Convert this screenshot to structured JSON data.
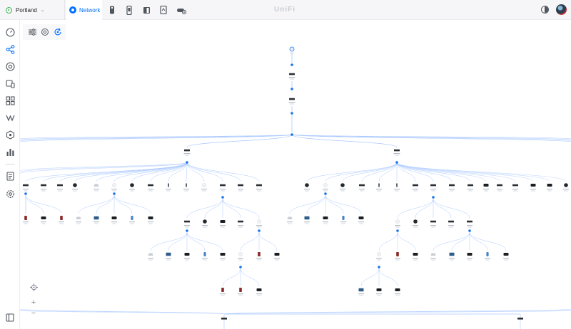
{
  "header": {
    "site_name": "Portland",
    "tabs": [
      {
        "label": "Network",
        "icon": "network-icon",
        "active": true
      },
      {
        "label": "",
        "icon": "protect-camera-icon"
      },
      {
        "label": "",
        "icon": "access-reader-icon"
      },
      {
        "label": "",
        "icon": "talk-phone-icon"
      },
      {
        "label": "",
        "icon": "connect-device-icon"
      },
      {
        "label": "",
        "icon": "cloud-gateway-icon"
      }
    ],
    "brand": "UniFi",
    "theme_icon": "contrast-icon",
    "avatar_icon": "user-avatar"
  },
  "sidebar": {
    "items": [
      {
        "icon": "dashboard-icon"
      },
      {
        "icon": "topology-icon",
        "active": true
      },
      {
        "icon": "devices-icon"
      },
      {
        "icon": "client-devices-icon"
      },
      {
        "icon": "apps-icon"
      },
      {
        "icon": "insights-icon"
      },
      {
        "icon": "traffic-icon"
      },
      {
        "icon": "statistics-icon"
      },
      {
        "icon": "system-log-icon"
      },
      {
        "icon": "settings-icon"
      }
    ],
    "footer_icon": "collapse-sidebar-icon"
  },
  "toolbar": {
    "items": [
      {
        "icon": "filter-sliders-icon"
      },
      {
        "icon": "target-view-icon"
      },
      {
        "icon": "refresh-layout-icon",
        "active": true
      }
    ]
  },
  "zoom": {
    "recenter_icon": "crosshair-icon",
    "zoom_in": "+",
    "zoom_out": "−"
  },
  "colors": {
    "accent": "#006fff",
    "link_line": "#a9c8ff",
    "node_dot": "#1a73e8",
    "online": "#39b54a"
  },
  "topology": {
    "root": {
      "icon": "internet-globe-icon"
    },
    "gateway": {
      "icon": "gateway-icon"
    },
    "core_switch": {
      "icon": "switch-icon"
    },
    "aggregation_switches": [
      {
        "icon": "switch-icon"
      },
      {
        "icon": "switch-icon"
      }
    ]
  }
}
